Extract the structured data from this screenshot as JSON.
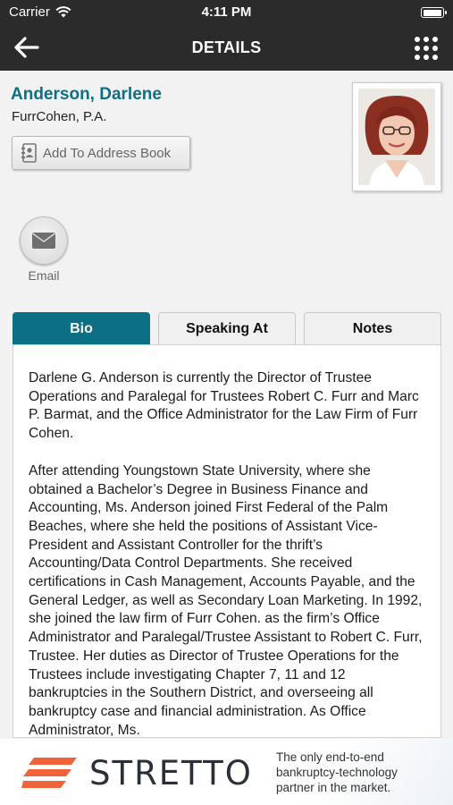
{
  "status_bar": {
    "carrier": "Carrier",
    "time": "4:11 PM"
  },
  "nav": {
    "title": "DETAILS",
    "back_icon": "arrow-left-icon",
    "menu_icon": "grid-dots-icon"
  },
  "contact": {
    "name": "Anderson, Darlene",
    "company": "FurrCohen, P.A.",
    "add_to_address_book": "Add To Address Book"
  },
  "actions": {
    "email_label": "Email"
  },
  "tabs": [
    {
      "label": "Bio",
      "active": true
    },
    {
      "label": "Speaking At",
      "active": false
    },
    {
      "label": "Notes",
      "active": false
    }
  ],
  "bio": {
    "paragraph_1": "Darlene G. Anderson is currently the Director of Trustee Operations and Paralegal for Trustees Robert C. Furr and Marc P. Barmat, and the Office Administrator for the Law Firm of Furr Cohen.",
    "paragraph_2": "After attending Youngstown State University, where she obtained a Bachelor’s Degree in Business Finance and Accounting, Ms. Anderson joined First Federal of the Palm Beaches, where she held the positions of Assistant Vice-President and Assistant Controller for the thrift’s Accounting/Data Control Departments.  She received certifications in Cash Management, Accounts Payable, and the General Ledger, as well as Secondary Loan Marketing.  In 1992, she joined the law firm of Furr Cohen. as the firm’s Office Administrator and Paralegal/Trustee Assistant to Robert C. Furr, Trustee.  Her duties as Director of Trustee Operations for the Trustees include investigating Chapter 7, 11 and 12 bankruptcies in the Southern District, and overseeing all bankruptcy case and financial administration. As Office Administrator, Ms."
  },
  "footer_ad": {
    "brand": "STRETTO",
    "tagline_line1": "The only end-to-end",
    "tagline_line2": "bankruptcy-technology",
    "tagline_line3": "partner in the market."
  },
  "colors": {
    "accent": "#0d6f84",
    "nav_bg": "#2b2b2b",
    "logo_orange": "#f0623a"
  }
}
